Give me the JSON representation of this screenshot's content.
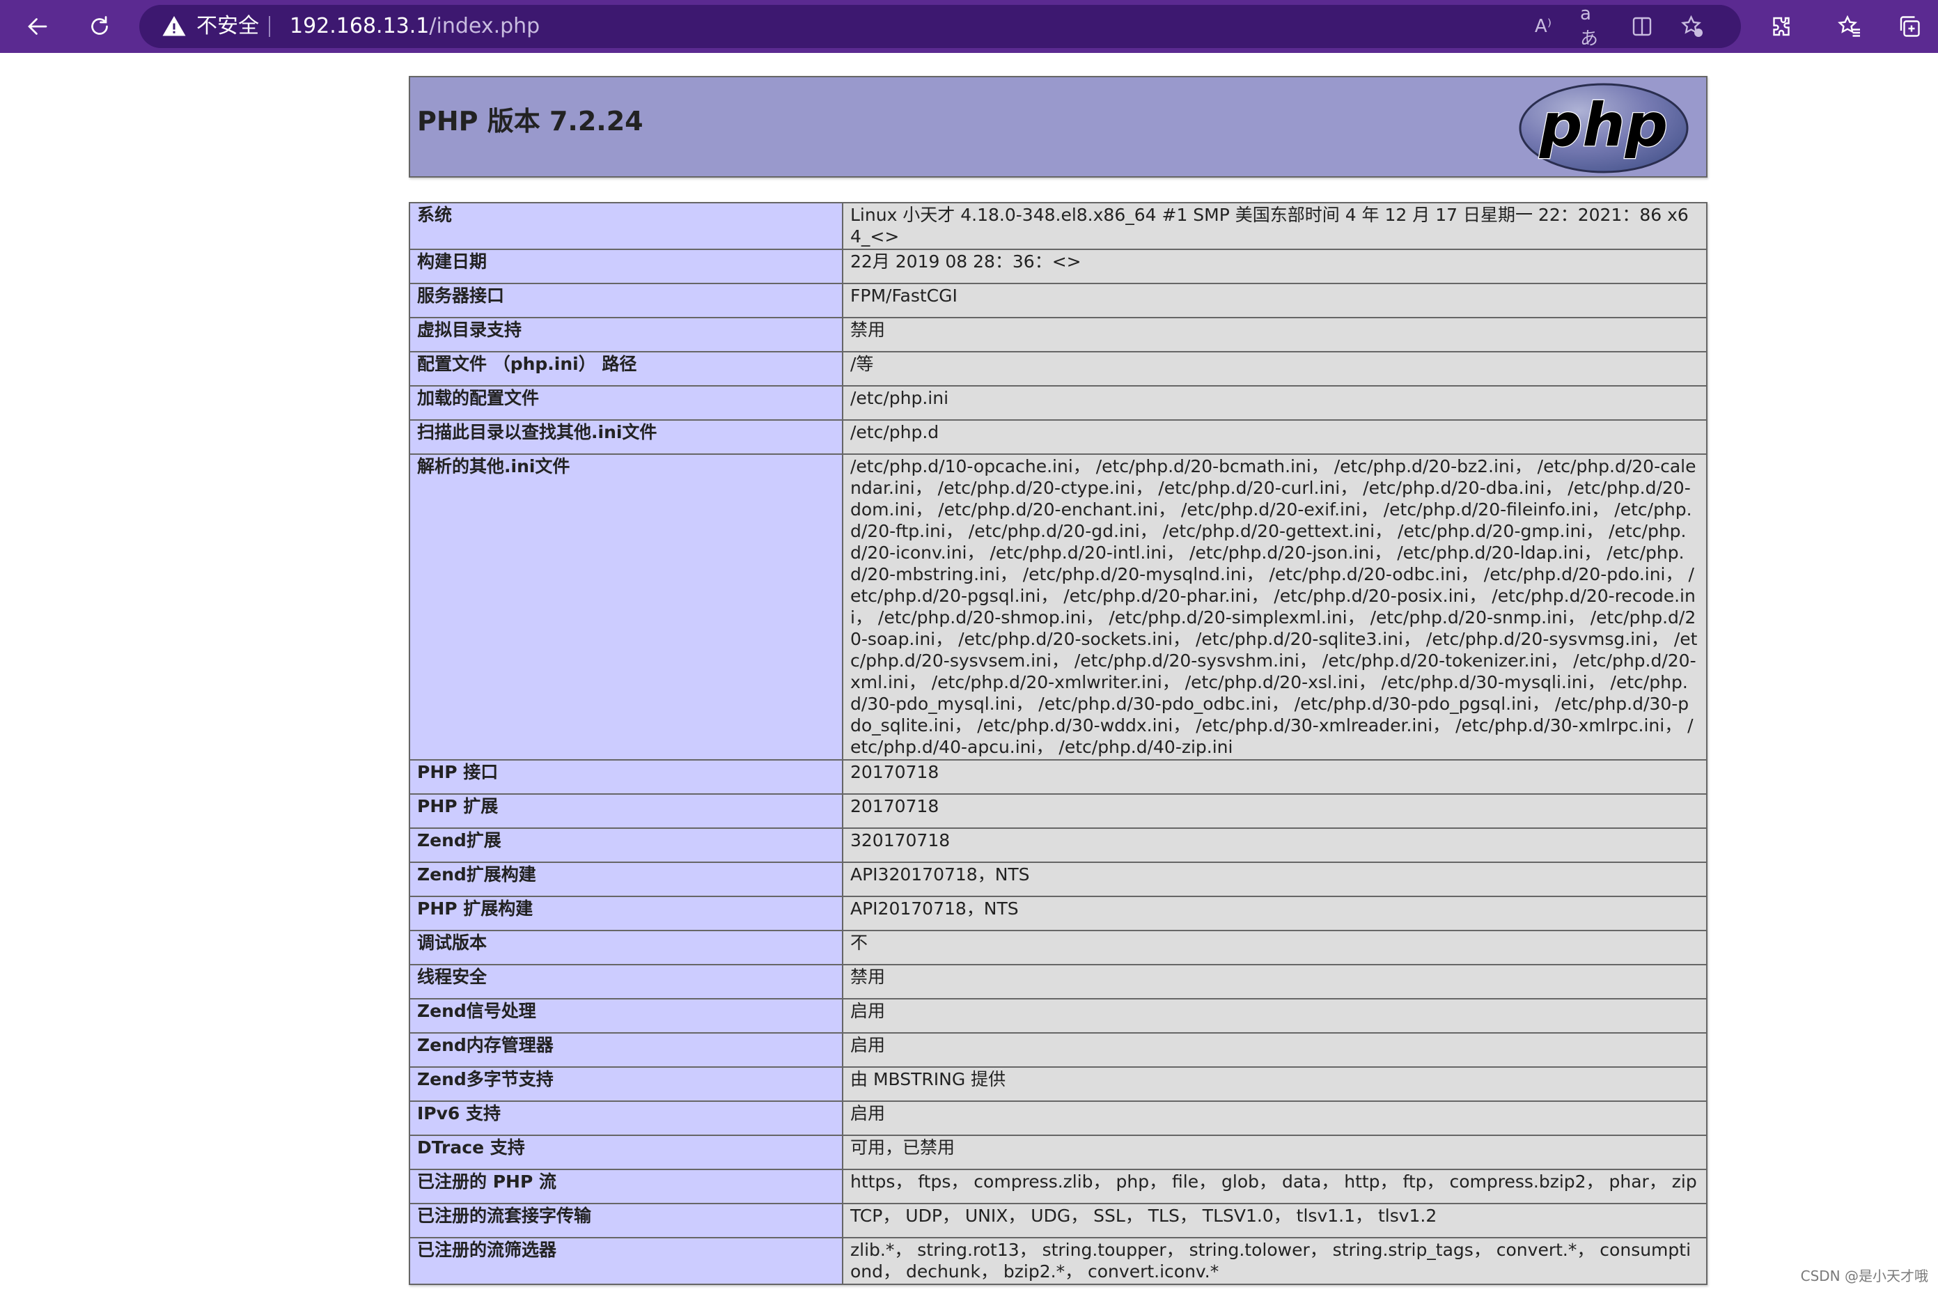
{
  "browser": {
    "security_label": "不安全",
    "url_host": "192.168.13.1",
    "url_path": "/index.php",
    "read_aloud_label": "A⁾",
    "translate_label": "aあ"
  },
  "header": {
    "title": "PHP 版本 7.2.24",
    "logo_text": "php"
  },
  "rows": [
    {
      "key": "系统",
      "value": "Linux 小天才 4.18.0-348.el8.x86_64 #1 SMP 美国东部时间 4 年 12 月 17 日星期一 22：2021：86 x64_<>"
    },
    {
      "key": "构建日期",
      "value": "22月 2019 08 28：36：<>"
    },
    {
      "key": "服务器接口",
      "value": "FPM/FastCGI"
    },
    {
      "key": "虚拟目录支持",
      "value": "禁用"
    },
    {
      "key": "配置文件 （php.ini） 路径",
      "value": "/等"
    },
    {
      "key": "加载的配置文件",
      "value": "/etc/php.ini"
    },
    {
      "key": "扫描此目录以查找其他.ini文件",
      "value": "/etc/php.d"
    },
    {
      "key": "解析的其他.ini文件",
      "value": "/etc/php.d/10-opcache.ini， /etc/php.d/20-bcmath.ini， /etc/php.d/20-bz2.ini， /etc/php.d/20-calendar.ini， /etc/php.d/20-ctype.ini， /etc/php.d/20-curl.ini， /etc/php.d/20-dba.ini， /etc/php.d/20-dom.ini， /etc/php.d/20-enchant.ini， /etc/php.d/20-exif.ini， /etc/php.d/20-fileinfo.ini， /etc/php.d/20-ftp.ini， /etc/php.d/20-gd.ini， /etc/php.d/20-gettext.ini， /etc/php.d/20-gmp.ini， /etc/php.d/20-iconv.ini， /etc/php.d/20-intl.ini， /etc/php.d/20-json.ini， /etc/php.d/20-ldap.ini， /etc/php.d/20-mbstring.ini， /etc/php.d/20-mysqlnd.ini， /etc/php.d/20-odbc.ini， /etc/php.d/20-pdo.ini， /etc/php.d/20-pgsql.ini， /etc/php.d/20-phar.ini， /etc/php.d/20-posix.ini， /etc/php.d/20-recode.ini， /etc/php.d/20-shmop.ini， /etc/php.d/20-simplexml.ini， /etc/php.d/20-snmp.ini， /etc/php.d/20-soap.ini， /etc/php.d/20-sockets.ini， /etc/php.d/20-sqlite3.ini， /etc/php.d/20-sysvmsg.ini， /etc/php.d/20-sysvsem.ini， /etc/php.d/20-sysvshm.ini， /etc/php.d/20-tokenizer.ini， /etc/php.d/20-xml.ini， /etc/php.d/20-xmlwriter.ini， /etc/php.d/20-xsl.ini， /etc/php.d/30-mysqli.ini， /etc/php.d/30-pdo_mysql.ini， /etc/php.d/30-pdo_odbc.ini， /etc/php.d/30-pdo_pgsql.ini， /etc/php.d/30-pdo_sqlite.ini， /etc/php.d/30-wddx.ini， /etc/php.d/30-xmlreader.ini， /etc/php.d/30-xmlrpc.ini， /etc/php.d/40-apcu.ini， /etc/php.d/40-zip.ini"
    },
    {
      "key": "PHP 接口",
      "value": "20170718"
    },
    {
      "key": "PHP 扩展",
      "value": "20170718"
    },
    {
      "key": "Zend扩展",
      "value": "320170718"
    },
    {
      "key": "Zend扩展构建",
      "value": "API320170718，NTS"
    },
    {
      "key": "PHP 扩展构建",
      "value": "API20170718，NTS"
    },
    {
      "key": "调试版本",
      "value": "不"
    },
    {
      "key": "线程安全",
      "value": "禁用"
    },
    {
      "key": "Zend信号处理",
      "value": "启用"
    },
    {
      "key": "Zend内存管理器",
      "value": "启用"
    },
    {
      "key": "Zend多字节支持",
      "value": "由 MBSTRING 提供"
    },
    {
      "key": "IPv6 支持",
      "value": "启用"
    },
    {
      "key": "DTrace 支持",
      "value": "可用，已禁用"
    },
    {
      "key": "已注册的 PHP 流",
      "value": "https， ftps， compress.zlib， php， file， glob， data， http， ftp， compress.bzip2， phar， zip"
    },
    {
      "key": "已注册的流套接字传输",
      "value": "TCP， UDP， UNIX， UDG， SSL， TLS， TLSV1.0， tlsv1.1， tlsv1.2"
    },
    {
      "key": "已注册的流筛选器",
      "value": "zlib.*， string.rot13， string.toupper， string.tolower， string.strip_tags， convert.*， consumptiond， dechunk， bzip2.*， convert.iconv.*"
    }
  ],
  "watermark": "CSDN @是小天才哦",
  "colors": {
    "toolbar": "#5b2a91",
    "header_bg": "#9999cc",
    "key_bg": "#ccccff",
    "value_bg": "#dddddd"
  }
}
